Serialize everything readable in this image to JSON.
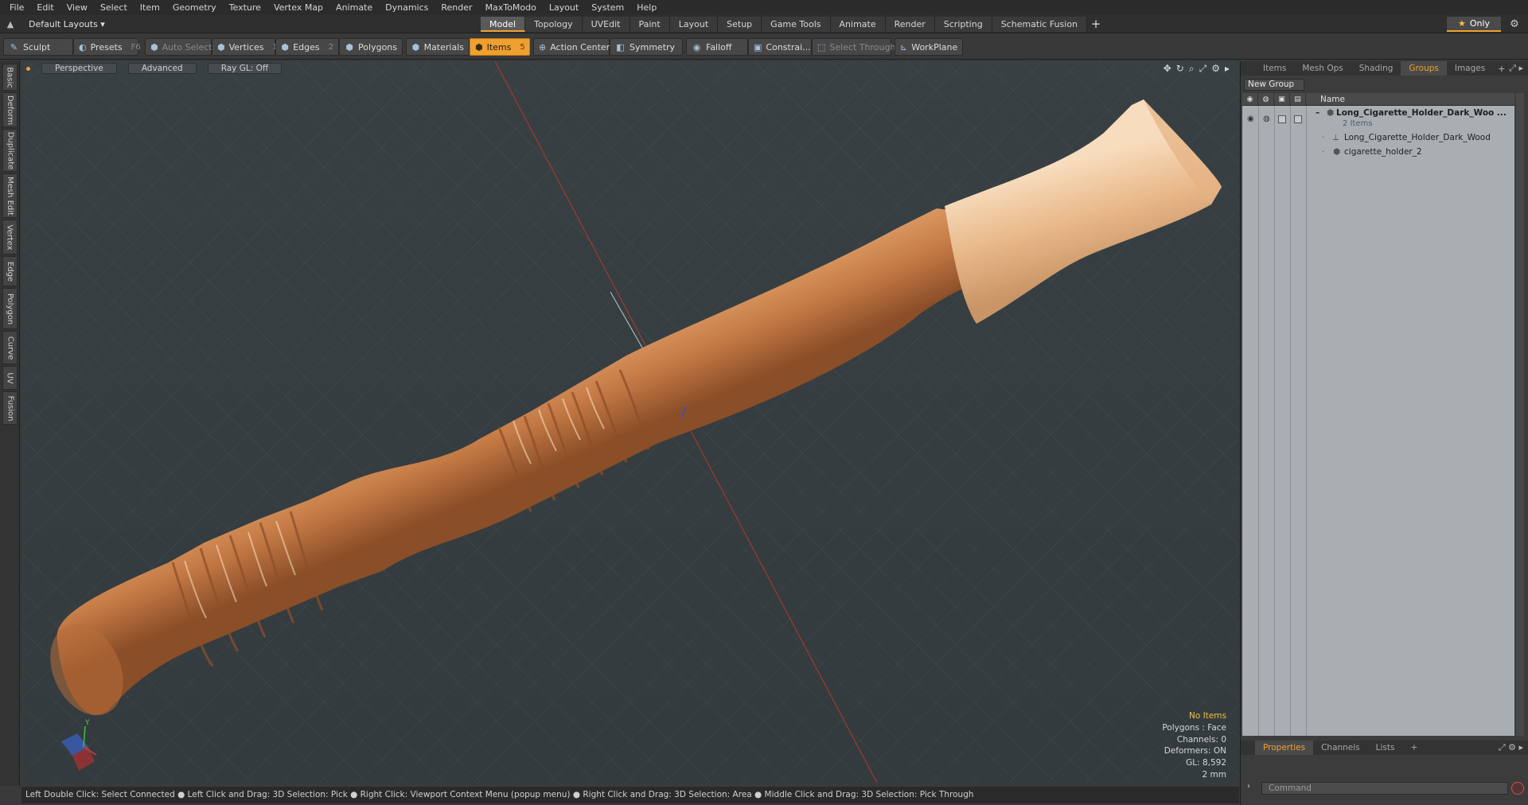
{
  "menu": [
    "File",
    "Edit",
    "View",
    "Select",
    "Item",
    "Geometry",
    "Texture",
    "Vertex Map",
    "Animate",
    "Dynamics",
    "Render",
    "MaxToModo",
    "Layout",
    "System",
    "Help"
  ],
  "layout": {
    "selector": "Default Layouts ▾",
    "tabs": [
      "Model",
      "Topology",
      "UVEdit",
      "Paint",
      "Layout",
      "Setup",
      "Game Tools",
      "Animate",
      "Render",
      "Scripting",
      "Schematic Fusion"
    ],
    "active_tab": "Model",
    "add_tab": "+",
    "only": "Only"
  },
  "toolbar": {
    "sculpt": "Sculpt",
    "presets": "Presets",
    "presets_key": "F6",
    "auto_select": "Auto Select",
    "vertices": "Vertices",
    "vertices_key": "1",
    "edges": "Edges",
    "edges_key": "2",
    "polygons": "Polygons",
    "materials": "Materials",
    "items": "Items",
    "items_key": "5",
    "action_center": "Action Center",
    "symmetry": "Symmetry",
    "falloff": "Falloff",
    "constraints": "Constrai...",
    "select_through": "Select Through",
    "workplane": "WorkPlane"
  },
  "left_tabs": [
    "Basic",
    "Deform",
    "Duplicate",
    "Mesh Edit",
    "Vertex",
    "Edge",
    "Polygon",
    "Curve",
    "UV",
    "Fusion"
  ],
  "viewport": {
    "view": "Perspective",
    "shading": "Advanced",
    "raygl": "Ray GL: Off",
    "info": {
      "selection": "No Items",
      "polygons": "Polygons : Face",
      "channels": "Channels: 0",
      "deformers": "Deformers: ON",
      "gl": "GL: 8,592",
      "scale": "2 mm"
    },
    "axis_y": "Y",
    "colors": {
      "wood": "#d08a55",
      "wood_light": "#e6b98c",
      "grid": "#3b4347",
      "axis_red": "#c0392b"
    }
  },
  "statusbar": "Left Double Click: Select Connected ● Left Click and Drag: 3D Selection: Pick ● Right Click: Viewport Context Menu (popup menu) ● Right Click and Drag: 3D Selection: Area ● Middle Click and Drag: 3D Selection: Pick Through",
  "right_panel": {
    "tabs": [
      "Items",
      "Mesh Ops",
      "Shading",
      "Groups",
      "Images"
    ],
    "active_tab": "Groups",
    "new_group": "New Group",
    "list_header": "Name",
    "group": {
      "name": "Long_Cigarette_Holder_Dark_Woo ...",
      "count": "2 Items",
      "children": [
        "Long_Cigarette_Holder_Dark_Wood",
        "cigarette_holder_2"
      ]
    },
    "bottom_tabs": [
      "Properties",
      "Channels",
      "Lists"
    ],
    "bottom_active": "Properties",
    "command_placeholder": "Command"
  }
}
